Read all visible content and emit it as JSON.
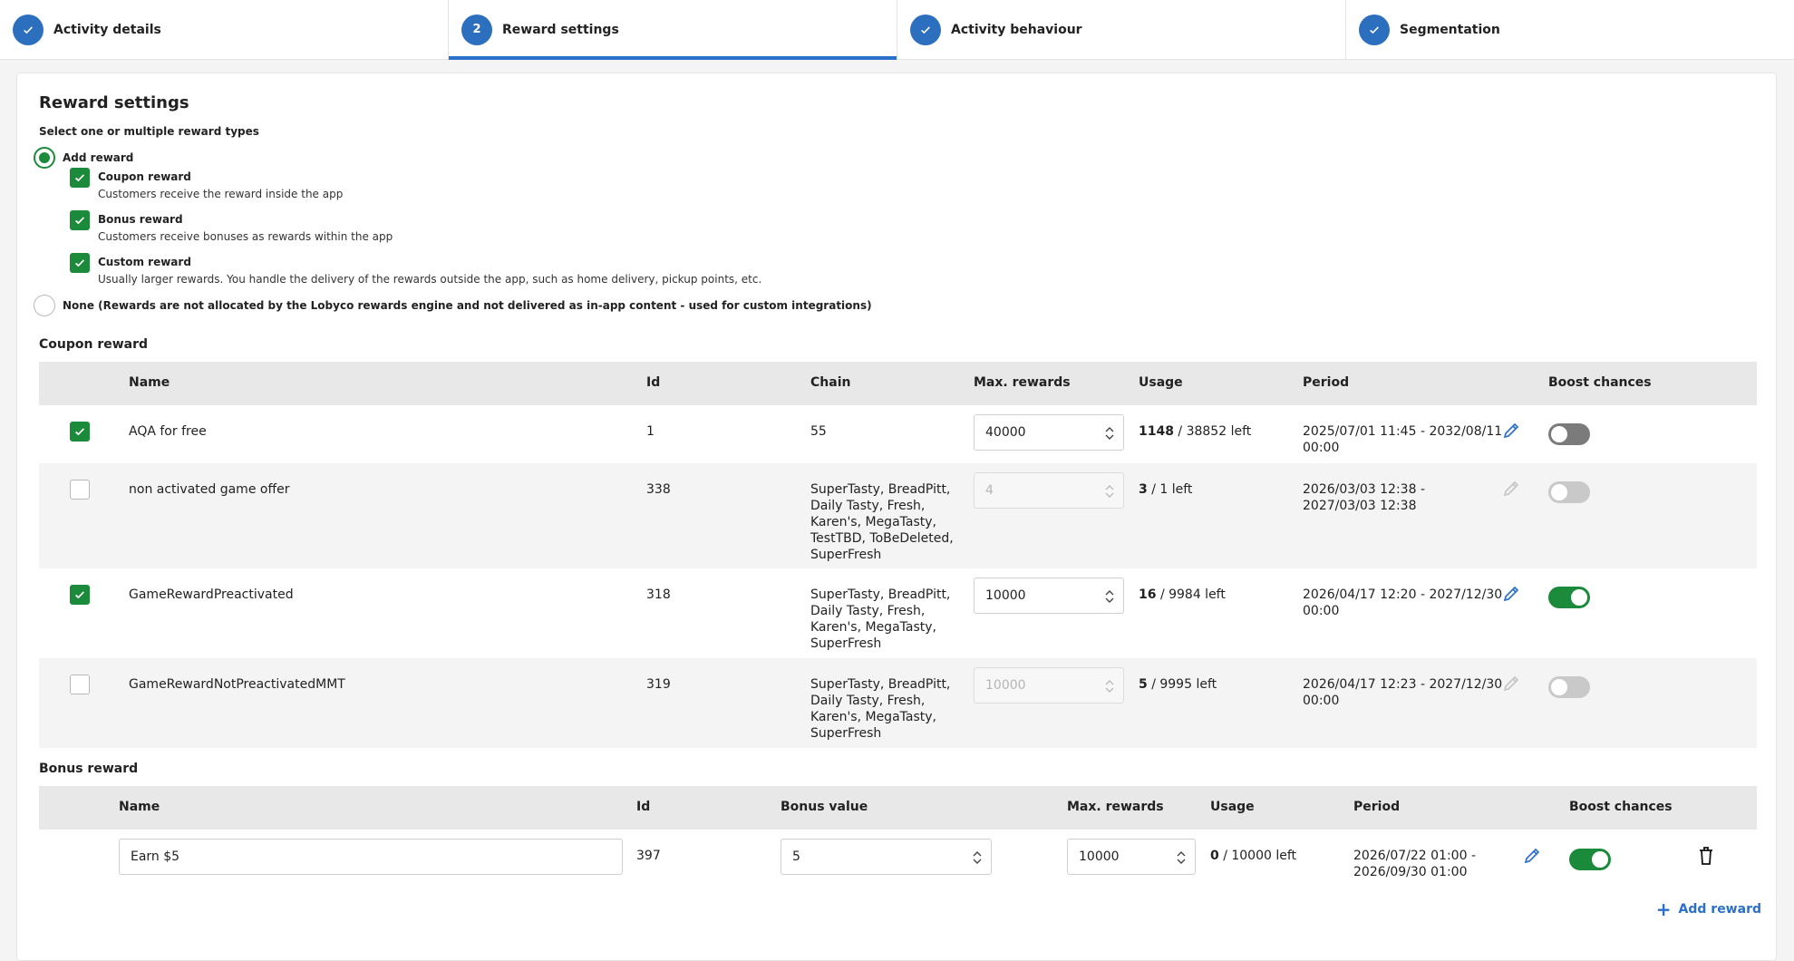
{
  "steps": [
    {
      "label": "Activity details",
      "state": "done"
    },
    {
      "label": "Reward settings",
      "state": "active",
      "number": "2"
    },
    {
      "label": "Activity behaviour",
      "state": "done"
    },
    {
      "label": "Segmentation",
      "state": "done"
    }
  ],
  "page": {
    "title": "Reward settings",
    "subtitle": "Select one or multiple reward types",
    "add_reward_label": "Add reward",
    "options": {
      "coupon": {
        "title": "Coupon reward",
        "desc": "Customers receive the reward inside the app"
      },
      "bonus": {
        "title": "Bonus reward",
        "desc": "Customers receive bonuses as rewards within the app"
      },
      "custom": {
        "title": "Custom reward",
        "desc": "Usually larger rewards. You handle the delivery of the rewards outside the app, such as home delivery, pickup points, etc."
      }
    },
    "none_label": "None (Rewards are not allocated by the Lobyco rewards engine and not delivered as in-app content - used for custom integrations)"
  },
  "coupon_table": {
    "section_title": "Coupon reward",
    "headers": {
      "name": "Name",
      "id": "Id",
      "chain": "Chain",
      "max": "Max. rewards",
      "usage": "Usage",
      "period": "Period",
      "boost": "Boost chances"
    },
    "rows": [
      {
        "name": "AQA for free",
        "id": "1",
        "chain": [
          "55"
        ],
        "max": "40000",
        "used": "1148",
        "left": "/ 38852 left",
        "period": [
          "2025/07/01 11:45 - 2032/08/11",
          "00:00"
        ]
      },
      {
        "name": "non activated game offer",
        "id": "338",
        "chain": [
          "SuperTasty, BreadPitt,",
          "Daily Tasty, Fresh,",
          "Karen's, MegaTasty,",
          "TestTBD, ToBeDeleted,",
          "SuperFresh"
        ],
        "max": "4",
        "used": "3",
        "left": "/ 1 left",
        "period": [
          "2026/03/03 12:38 -",
          "2027/03/03 12:38"
        ]
      },
      {
        "name": "GameRewardPreactivated",
        "id": "318",
        "chain": [
          "SuperTasty, BreadPitt,",
          "Daily Tasty, Fresh,",
          "Karen's, MegaTasty,",
          "SuperFresh"
        ],
        "max": "10000",
        "used": "16",
        "left": "/ 9984 left",
        "period": [
          "2026/04/17 12:20 - 2027/12/30",
          "00:00"
        ]
      },
      {
        "name": "GameRewardNotPreactivatedMMT",
        "id": "319",
        "chain": [
          "SuperTasty, BreadPitt,",
          "Daily Tasty, Fresh,",
          "Karen's, MegaTasty,",
          "SuperFresh"
        ],
        "max": "10000",
        "used": "5",
        "left": "/ 9995 left",
        "period": [
          "2026/04/17 12:23 - 2027/12/30",
          "00:00"
        ]
      }
    ]
  },
  "bonus_table": {
    "section_title": "Bonus reward",
    "headers": {
      "name": "Name",
      "id": "Id",
      "bonus": "Bonus value",
      "max": "Max. rewards",
      "usage": "Usage",
      "period": "Period",
      "boost": "Boost chances"
    },
    "row": {
      "name": "Earn $5",
      "id": "397",
      "bonus": "5",
      "max": "10000",
      "used": "0",
      "left": "/ 10000 left",
      "period": [
        "2026/07/22 01:00 -",
        "2026/09/30 01:00"
      ]
    },
    "add_label": "Add reward"
  },
  "colors": {
    "accent": "#2a6fc9",
    "success": "#1b8a3a"
  }
}
